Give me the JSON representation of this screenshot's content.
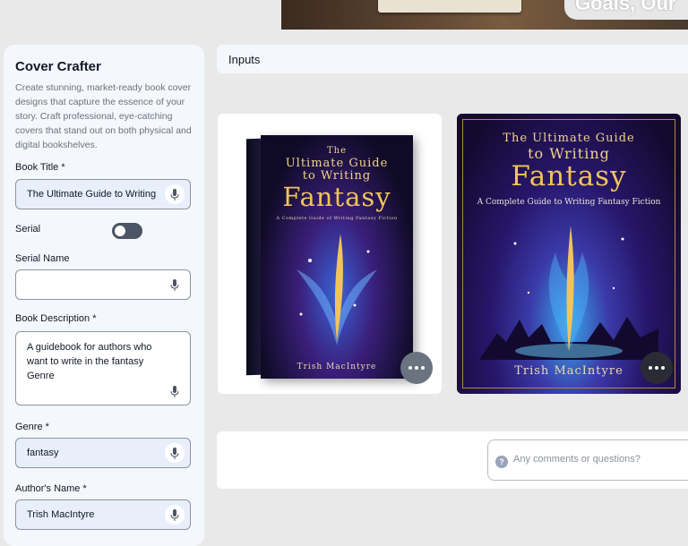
{
  "app": {
    "title": "Cover Crafter",
    "description": "Create stunning, market-ready book cover designs that capture the essence of your story. Craft professional, eye-catching covers that stand out on both physical and digital bookshelves."
  },
  "banner": {
    "text": "Goals, Our"
  },
  "form": {
    "book_title": {
      "label": "Book Title *",
      "value": "The Ultimate Guide to Writing Fantasy"
    },
    "serial": {
      "label": "Serial",
      "enabled": false
    },
    "serial_name": {
      "label": "Serial Name",
      "value": ""
    },
    "book_description": {
      "label": "Book Description *",
      "value": "A guidebook for authors who want to write in the fantasy Genre"
    },
    "genre": {
      "label": "Genre *",
      "value": "fantasy"
    },
    "author_name": {
      "label": "Author's Name *",
      "value": "Trish MacIntyre"
    }
  },
  "inputs_section": {
    "title": "Inputs"
  },
  "covers": [
    {
      "line1": "The",
      "line2": "Ultimate Guide",
      "line3": "to Writing",
      "line4": "Fantasy",
      "subtitle": "A Complete Guide of Writing Fantasy Fiction",
      "author": "Trish MacIntyre"
    },
    {
      "line1": "The Ultimate Guide",
      "line2": "to Writing",
      "line3": "Fantasy",
      "subtitle": "A Complete Guide to Writing Fantasy Fiction",
      "author": "Trish MacIntyre"
    }
  ],
  "comments": {
    "placeholder": "Any comments or questions?",
    "help_icon": "?"
  }
}
